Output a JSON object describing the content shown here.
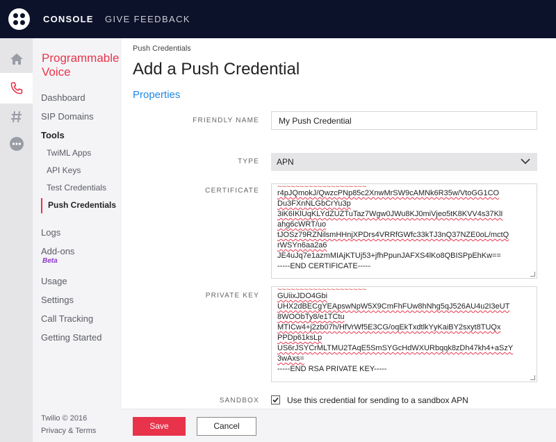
{
  "topbar": {
    "console": "CONSOLE",
    "feedback": "GIVE FEEDBACK"
  },
  "rail": {
    "icons": [
      "home-icon",
      "phone-icon",
      "hash-icon",
      "more-icon"
    ]
  },
  "product": {
    "title": "Programmable Voice",
    "nav": {
      "dashboard": "Dashboard",
      "sip_domains": "SIP Domains",
      "tools": "Tools",
      "twiml_apps": "TwiML Apps",
      "api_keys": "API Keys",
      "test_credentials": "Test Credentials",
      "push_credentials": "Push Credentials",
      "logs": "Logs",
      "addons": "Add-ons",
      "beta": "Beta",
      "usage": "Usage",
      "settings": "Settings",
      "call_tracking": "Call Tracking",
      "getting_started": "Getting Started"
    },
    "footer": {
      "copyright": "Twilio © 2016",
      "privacy": "Privacy & Terms"
    }
  },
  "page": {
    "breadcrumb": "Push Credentials",
    "title": "Add a Push Credential",
    "section": "Properties"
  },
  "form": {
    "friendly_name": {
      "label": "FRIENDLY NAME",
      "value": "My Push Credential"
    },
    "type": {
      "label": "TYPE",
      "value": "APN"
    },
    "certificate": {
      "label": "CERTIFICATE",
      "lines": [
        "r4pJQmokJ/QwzcPNp85c2XnwMrSW9cAMNk6R35w/VtoGG1CO",
        "Du3FXnNLGbCrYu3p",
        "3iK6IKlUqKLYdZUZTuTaz7Wgw0JWu8KJ0miVjeo5tK8KVV4s37KlI",
        "ahg6cWRT/uo",
        "tJOSz79RZNilsmHHnjXPDrs4VRRfGWfc33kTJ3nQ37NZE0oL/mctQ",
        "rWSYn6aa2a6",
        "JE4uJq7e1azmMIAjKTUj53+jfhPpunJAFXS4lKo8QBISPpEhKw==",
        "-----END CERTIFICATE-----"
      ]
    },
    "private_key": {
      "label": "PRIVATE KEY",
      "lines": [
        "GUiixJDO4Gbi",
        "UHX2dBECgYEApswNpW5X9CmFhFUw8hNhg5qJ526AU4u2I3eUT",
        "8WOObTy8/e1TCtu",
        "MTICw4+j2zb07h/HfVrWf5E3CG/oqEkTxdtlkYyKaiBY2sxyt8TUQx",
        "PPDp61ksLp",
        "US6rJSYCrMLTMU2TAqE5SmSYGcHdWXURbqqk8zDh47kh4+aSzY",
        "3wAxs=",
        "-----END RSA PRIVATE KEY-----"
      ]
    },
    "sandbox": {
      "label": "SANDBOX",
      "text": "Use this credential for sending to a sandbox APN",
      "checked": true
    }
  },
  "actions": {
    "save": "Save",
    "cancel": "Cancel"
  },
  "colors": {
    "brand_red": "#e8334b",
    "topbar": "#0d122b",
    "link_blue": "#1f87e4"
  }
}
